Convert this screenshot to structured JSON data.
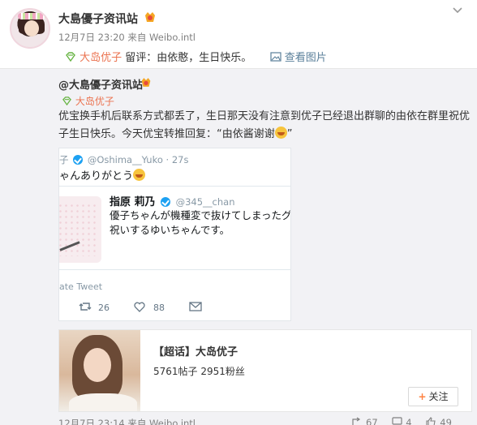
{
  "post": {
    "author": "大島優子资讯站",
    "time": "12月7日 23:20 来自 Weibo.intl",
    "forward_user": "大岛优子",
    "forward_text": "留评：由依憨，生日快乐。",
    "view_image": "查看图片"
  },
  "repost": {
    "author": "@大島優子资讯站",
    "super_topic": "大岛优子",
    "text": "优宝换手机后联系方式都丢了，生日那天没有注意到优子已经退出群聊的由依在群里祝优子生日快乐。今天优宝转推回复：“由依酱谢谢",
    "text_end": "”",
    "time": "12月7日 23:14 来自 Weibo.intl",
    "shares": "67",
    "comments": "4",
    "likes": "49"
  },
  "tweet": {
    "head_prefix": "子",
    "handle": "@Oshima__Yuko · 27s",
    "line2": "ゃんありがとう",
    "quoted_name": "指原 莉乃",
    "quoted_handle": "@345__chan",
    "quoted_line1": "優子ちゃんが機種変で抜けてしまったグル",
    "quoted_line2": "祝いするゆいちゃんです。",
    "footer": "ate Tweet",
    "retweets": "26",
    "likes": "88"
  },
  "card": {
    "title": "【超话】大岛优子",
    "stats": "5761帖子 2951粉丝",
    "follow": "关注"
  },
  "colors": {
    "link": "#eb7350",
    "gray_bg": "#f2f2f5",
    "twitter_blue": "#1da1f2"
  }
}
